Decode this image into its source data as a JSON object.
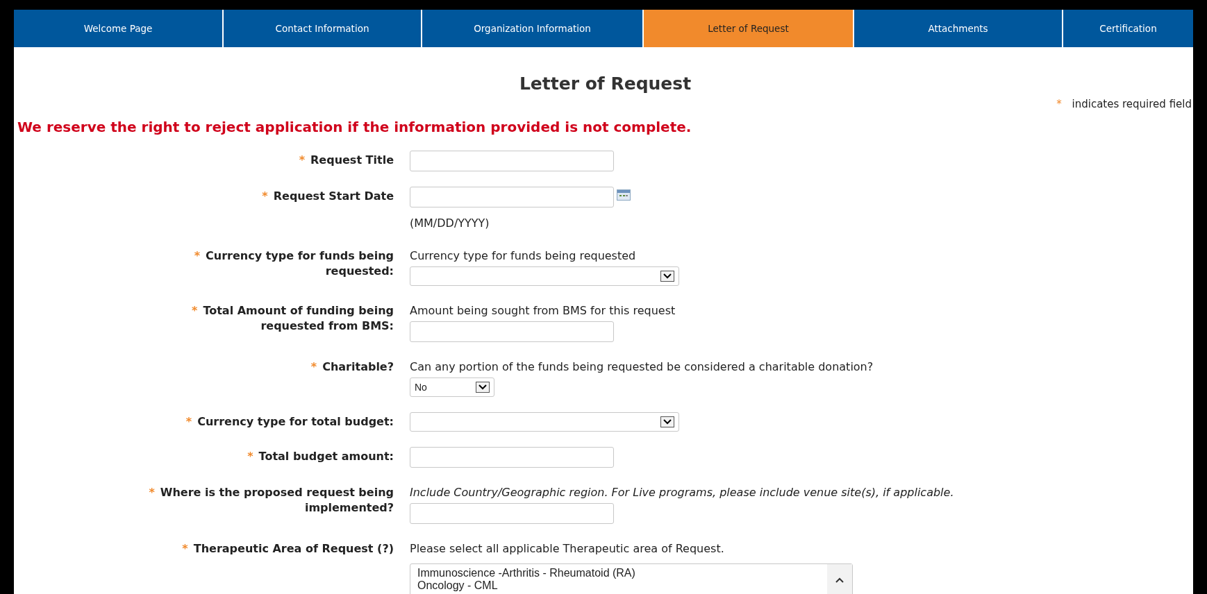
{
  "tabs": [
    {
      "label": "Welcome Page",
      "selected": false
    },
    {
      "label": "Contact Information",
      "selected": false
    },
    {
      "label": "Organization Information",
      "selected": false
    },
    {
      "label": "Letter of Request",
      "selected": true
    },
    {
      "label": "Attachments",
      "selected": false
    },
    {
      "label": "Certification",
      "selected": false
    }
  ],
  "page_title": "Letter of Request",
  "required_note": {
    "mark": "*",
    "text": "indicates required field"
  },
  "warning": "We reserve the right to reject application if the information provided is not complete.",
  "fields": [
    {
      "kind": "text",
      "required": true,
      "label": "Request Title"
    },
    {
      "kind": "date",
      "required": true,
      "label": "Request Start Date",
      "format_hint": "(MM/DD/YYYY)"
    },
    {
      "kind": "select",
      "required": true,
      "label": "Currency type for funds being requested:",
      "hint": "Currency type for funds being requested"
    },
    {
      "kind": "text",
      "required": true,
      "label": "Total Amount of funding being requested from BMS:",
      "hint": "Amount being sought from BMS for this request"
    },
    {
      "kind": "short-select",
      "required": true,
      "label": "Charitable?",
      "hint": "Can any portion of the funds being requested be considered a charitable donation?",
      "value": "No"
    },
    {
      "kind": "select",
      "required": true,
      "label": "Currency type for total budget:"
    },
    {
      "kind": "text",
      "required": true,
      "label": "Total budget amount:"
    },
    {
      "kind": "text",
      "required": true,
      "label": "Where is the proposed request being implemented?",
      "hint": "Include Country/Geographic region. For Live programs, please include venue site(s), if applicable.",
      "hint_italic": true
    },
    {
      "kind": "listbox",
      "required": true,
      "label": "Therapeutic Area of Request (?)",
      "hint": "Please select all applicable Therapeutic area of Request.",
      "options": [
        "Immunoscience -Arthritis - Rheumatoid (RA)",
        "Oncology - CML"
      ]
    }
  ]
}
